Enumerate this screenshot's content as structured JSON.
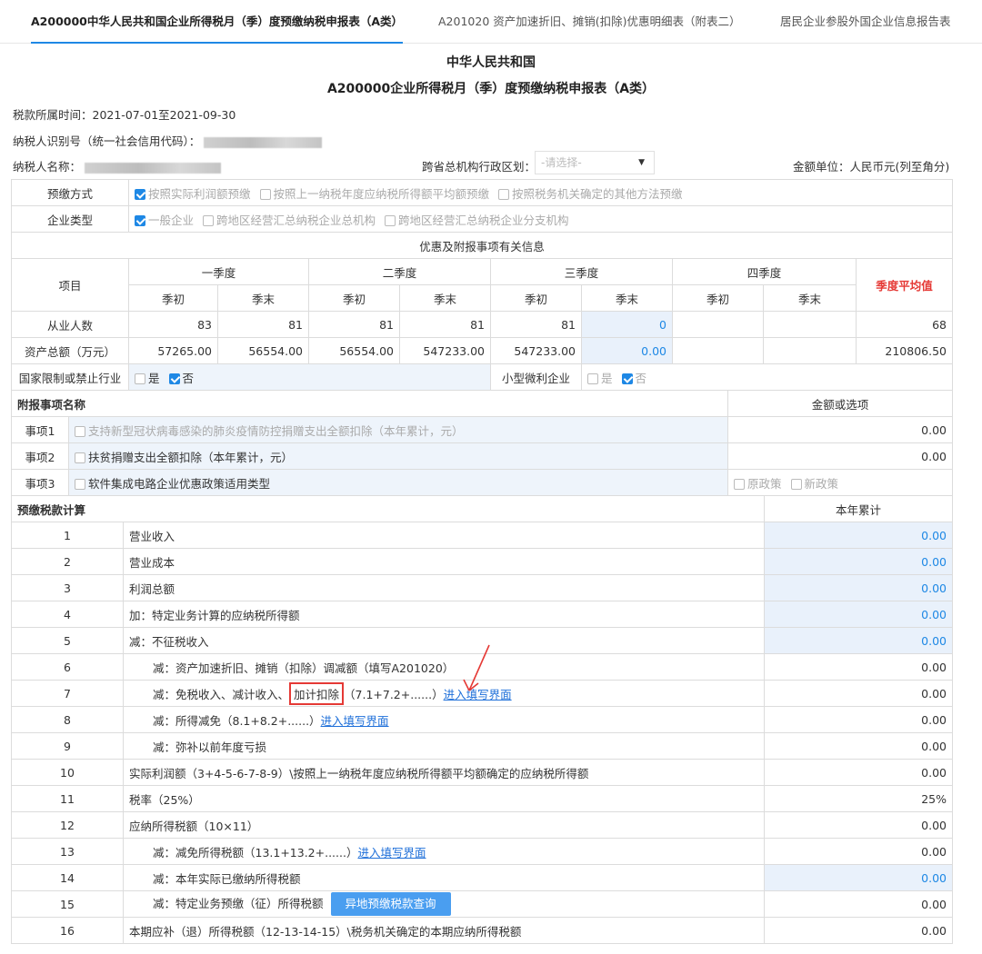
{
  "tabs": [
    {
      "label": "A200000中华人民共和国企业所得税月（季）度预缴纳税申报表（A类）"
    },
    {
      "label": "A201020 资产加速折旧、摊销(扣除)优惠明细表（附表二）"
    },
    {
      "label": "居民企业参股外国企业信息报告表"
    }
  ],
  "header": {
    "title1": "中华人民共和国",
    "title2": "A200000企业所得税月（季）度预缴纳税申报表（A类）",
    "period": "税款所属时间：2021-07-01至2021-09-30",
    "taxpayer_id_label": "纳税人识别号（统一社会信用代码）：",
    "taxpayer_name_label": "纳税人名称：",
    "region_label": "跨省总机构行政区划：",
    "region_placeholder": "-请选择-",
    "unit": "金额单位：人民币元(列至角分)"
  },
  "prepay": {
    "label": "预缴方式",
    "opt1": "按照实际利润额预缴",
    "opt2": "按照上一纳税年度应纳税所得额平均额预缴",
    "opt3": "按照税务机关确定的其他方法预缴"
  },
  "enterprise": {
    "label": "企业类型",
    "opt1": "一般企业",
    "opt2": "跨地区经营汇总纳税企业总机构",
    "opt3": "跨地区经营汇总纳税企业分支机构"
  },
  "pref": {
    "title": "优惠及附报事项有关信息",
    "item": "项目",
    "q1": "一季度",
    "q2": "二季度",
    "q3": "三季度",
    "q4": "四季度",
    "start": "季初",
    "end": "季末",
    "avg": "季度平均值",
    "emp_label": "从业人数",
    "emp": [
      "83",
      "81",
      "81",
      "81",
      "81",
      "0",
      "",
      ""
    ],
    "emp_avg": "68",
    "assets_label": "资产总额（万元）",
    "assets": [
      "57265.00",
      "56554.00",
      "56554.00",
      "547233.00",
      "547233.00",
      "0.00",
      "",
      ""
    ],
    "assets_avg": "210806.50",
    "restricted_label": "国家限制或禁止行业",
    "yes": "是",
    "no": "否",
    "small_label": "小型微利企业"
  },
  "attach": {
    "name_header": "附报事项名称",
    "amount_header": "金额或选项",
    "items": [
      {
        "label": "事项1",
        "text": "支持新型冠状病毒感染的肺炎疫情防控捐赠支出全额扣除（本年累计，元）",
        "value": "0.00"
      },
      {
        "label": "事项2",
        "text": "扶贫捐赠支出全额扣除（本年累计，元）",
        "value": "0.00"
      },
      {
        "label": "事项3",
        "text": "软件集成电路企业优惠政策适用类型",
        "opt1": "原政策",
        "opt2": "新政策"
      }
    ]
  },
  "calc": {
    "title": "预缴税款计算",
    "year_header": "本年累计",
    "rows": [
      {
        "no": "1",
        "text": "营业收入",
        "value": "0.00"
      },
      {
        "no": "2",
        "text": "营业成本",
        "value": "0.00"
      },
      {
        "no": "3",
        "text": "利润总额",
        "value": "0.00"
      },
      {
        "no": "4",
        "text": "加：特定业务计算的应纳税所得额",
        "value": "0.00"
      },
      {
        "no": "5",
        "text": "减：不征税收入",
        "value": "0.00"
      },
      {
        "no": "6",
        "text": "减：资产加速折旧、摊销（扣除）调减额（填写A201020）",
        "value": "0.00"
      },
      {
        "no": "7",
        "pre": "减：免税收入、减计收入、",
        "box": "加计扣除",
        "post": "（7.1+7.2+......）",
        "link": "进入填写界面",
        "value": "0.00"
      },
      {
        "no": "8",
        "pre": "减：所得减免（8.1+8.2+......）",
        "link": "进入填写界面",
        "value": "0.00"
      },
      {
        "no": "9",
        "text": "减：弥补以前年度亏损",
        "value": "0.00"
      },
      {
        "no": "10",
        "text": "实际利润额（3+4-5-6-7-8-9）\\按照上一纳税年度应纳税所得额平均额确定的应纳税所得额",
        "value": "0.00"
      },
      {
        "no": "11",
        "text": "税率（25%）",
        "value": "25%"
      },
      {
        "no": "12",
        "text": "应纳所得税额（10×11）",
        "value": "0.00"
      },
      {
        "no": "13",
        "pre": "减：减免所得税额（13.1+13.2+......）",
        "link": "进入填写界面",
        "value": "0.00"
      },
      {
        "no": "14",
        "text": "减：本年实际已缴纳所得税额",
        "value": "0.00"
      },
      {
        "no": "15",
        "text": "减：特定业务预缴（征）所得税额",
        "button": "异地预缴税款查询",
        "value": "0.00"
      },
      {
        "no": "16",
        "text": "本期应补（退）所得税额（12-13-14-15）\\税务机关确定的本期应纳所得税额",
        "value": "0.00"
      }
    ]
  },
  "colors": {
    "accent": "#1e88e5",
    "annotation": "#e53935",
    "input_bg": "#e9f1fb"
  }
}
